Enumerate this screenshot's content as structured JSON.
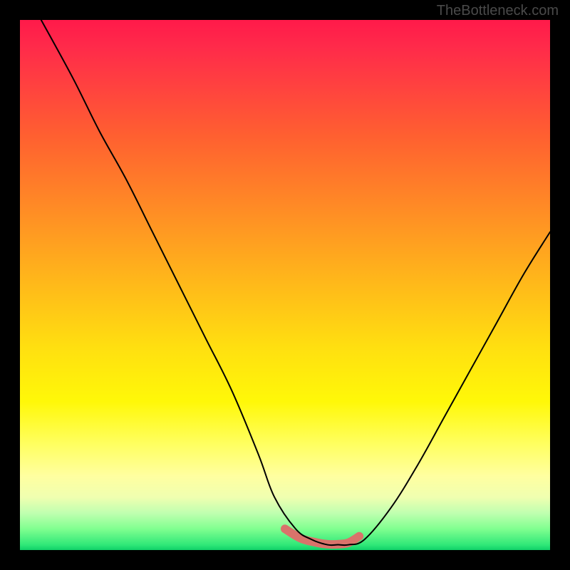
{
  "watermark": "TheBottleneck.com",
  "chart_data": {
    "type": "line",
    "title": "",
    "xlabel": "",
    "ylabel": "",
    "xlim": [
      0,
      100
    ],
    "ylim": [
      0,
      100
    ],
    "series": [
      {
        "name": "bottleneck-curve",
        "x": [
          4,
          10,
          15,
          20,
          25,
          30,
          35,
          40,
          45,
          48,
          52,
          55,
          58,
          60,
          62,
          65,
          70,
          75,
          80,
          85,
          90,
          95,
          100
        ],
        "values": [
          100,
          89,
          79,
          70,
          60,
          50,
          40,
          30,
          18,
          10,
          4,
          2,
          1,
          1,
          1,
          2,
          8,
          16,
          25,
          34,
          43,
          52,
          60
        ]
      }
    ],
    "highlight": {
      "name": "optimal-range",
      "x": [
        50,
        53,
        56,
        58,
        60,
        62,
        64
      ],
      "values": [
        4,
        2.2,
        1.4,
        1.1,
        1.1,
        1.4,
        2.6
      ]
    },
    "colors": {
      "gradient_top": "#ff1a4a",
      "gradient_mid": "#ffe010",
      "gradient_bottom": "#10d068",
      "curve": "#000000",
      "highlight": "#d9736b",
      "frame": "#000000"
    }
  }
}
